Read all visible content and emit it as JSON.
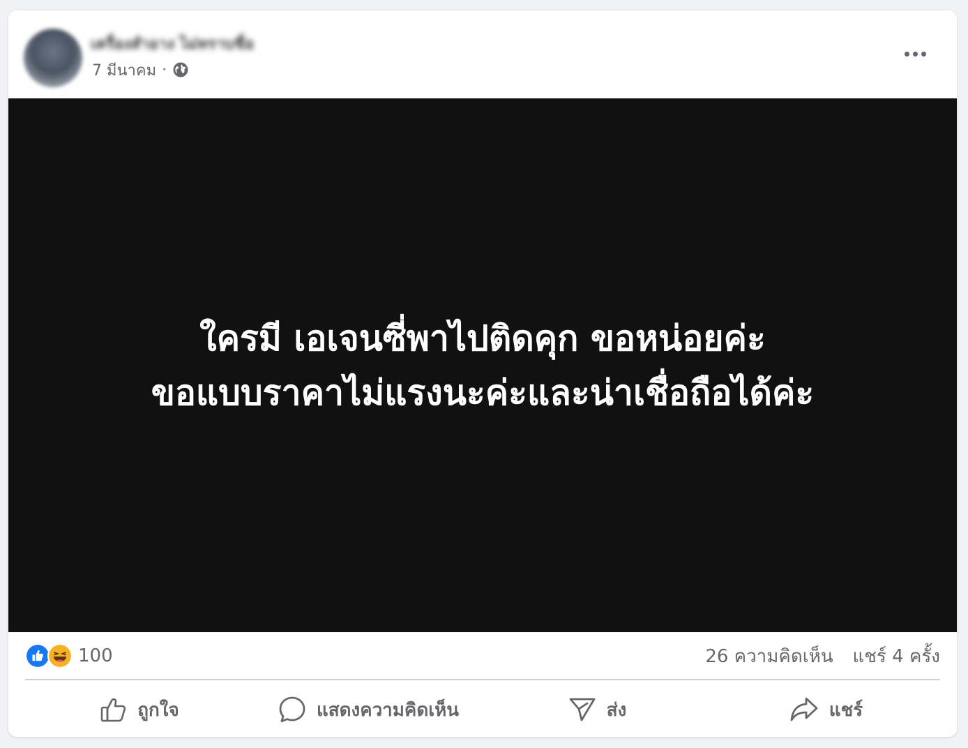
{
  "post": {
    "author_name": "เครื่องสำอาง ไม่ทราบชื่อ",
    "date": "7 มีนาคม",
    "separator": "·",
    "privacy_icon": "globe-icon",
    "more_icon": "more-options-icon"
  },
  "media": {
    "line1": "ใครมี เอเจนซี่พาไปติดคุก ขอหน่อยค่ะ",
    "line2": "ขอแบบราคาไม่แรงนะค่ะและน่าเชื่อถือได้ค่ะ"
  },
  "stats": {
    "reaction_count": "100",
    "comments": "26 ความคิดเห็น",
    "shares": "แชร์ 4 ครั้ง",
    "reaction_icons": [
      "like-icon",
      "haha-icon"
    ]
  },
  "actions": {
    "like": "ถูกใจ",
    "comment": "แสดงความคิดเห็น",
    "send": "ส่ง",
    "share": "แชร์"
  },
  "colors": {
    "like_blue": "#1877f2",
    "haha_yellow": "#f7b125",
    "secondary_text": "#65676b",
    "media_bg": "#111111"
  }
}
